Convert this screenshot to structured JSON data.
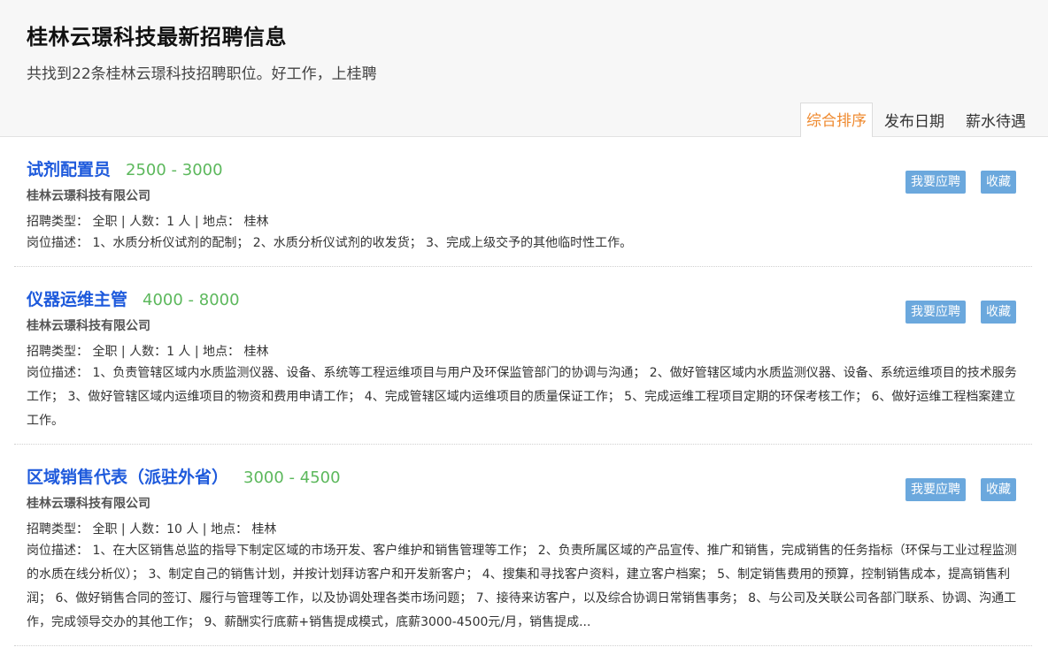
{
  "header": {
    "title": "桂林云璟科技最新招聘信息",
    "subtitle": "共找到22条桂林云璟科技招聘职位。好工作，上桂聘",
    "sort_tabs": [
      {
        "label": "综合排序",
        "active": true
      },
      {
        "label": "发布日期",
        "active": false
      },
      {
        "label": "薪水待遇",
        "active": false
      }
    ]
  },
  "actions": {
    "apply_label": "我要应聘",
    "favorite_label": "收藏"
  },
  "jobs": [
    {
      "title": "试剂配置员",
      "salary": "2500 - 3000",
      "company": "桂林云璟科技有限公司",
      "meta": "招聘类型：  全职 | 人数：1 人 | 地点：  桂林",
      "description": "岗位描述：  1、水质分析仪试剂的配制；  2、水质分析仪试剂的收发货；  3、完成上级交予的其他临时性工作。"
    },
    {
      "title": "仪器运维主管",
      "salary": "4000 - 8000",
      "company": "桂林云璟科技有限公司",
      "meta": "招聘类型：  全职 | 人数：1 人 | 地点：  桂林",
      "description": "岗位描述：  1、负责管辖区域内水质监测仪器、设备、系统等工程运维项目与用户及环保监管部门的协调与沟通；  2、做好管辖区域内水质监测仪器、设备、系统运维项目的技术服务工作；  3、做好管辖区域内运维项目的物资和费用申请工作；  4、完成管辖区域内运维项目的质量保证工作；  5、完成运维工程项目定期的环保考核工作；  6、做好运维工程档案建立工作。"
    },
    {
      "title": "区域销售代表（派驻外省）",
      "salary": "3000 - 4500",
      "company": "桂林云璟科技有限公司",
      "meta": "招聘类型：  全职 | 人数：10 人 | 地点：  桂林",
      "description": "岗位描述：  1、在大区销售总监的指导下制定区域的市场开发、客户维护和销售管理等工作；  2、负责所属区域的产品宣传、推广和销售，完成销售的任务指标（环保与工业过程监测的水质在线分析仪）；  3、制定自己的销售计划，并按计划拜访客户和开发新客户；  4、搜集和寻找客户资料，建立客户档案；  5、制定销售费用的预算，控制销售成本，提高销售利润；  6、做好销售合同的签订、履行与管理等工作，以及协调处理各类市场问题；  7、接待来访客户，以及综合协调日常销售事务；  8、与公司及关联公司各部门联系、协调、沟通工作，完成领导交办的其他工作；  9、薪酬实行底薪+销售提成模式，底薪3000-4500元/月，销售提成..."
    }
  ]
}
